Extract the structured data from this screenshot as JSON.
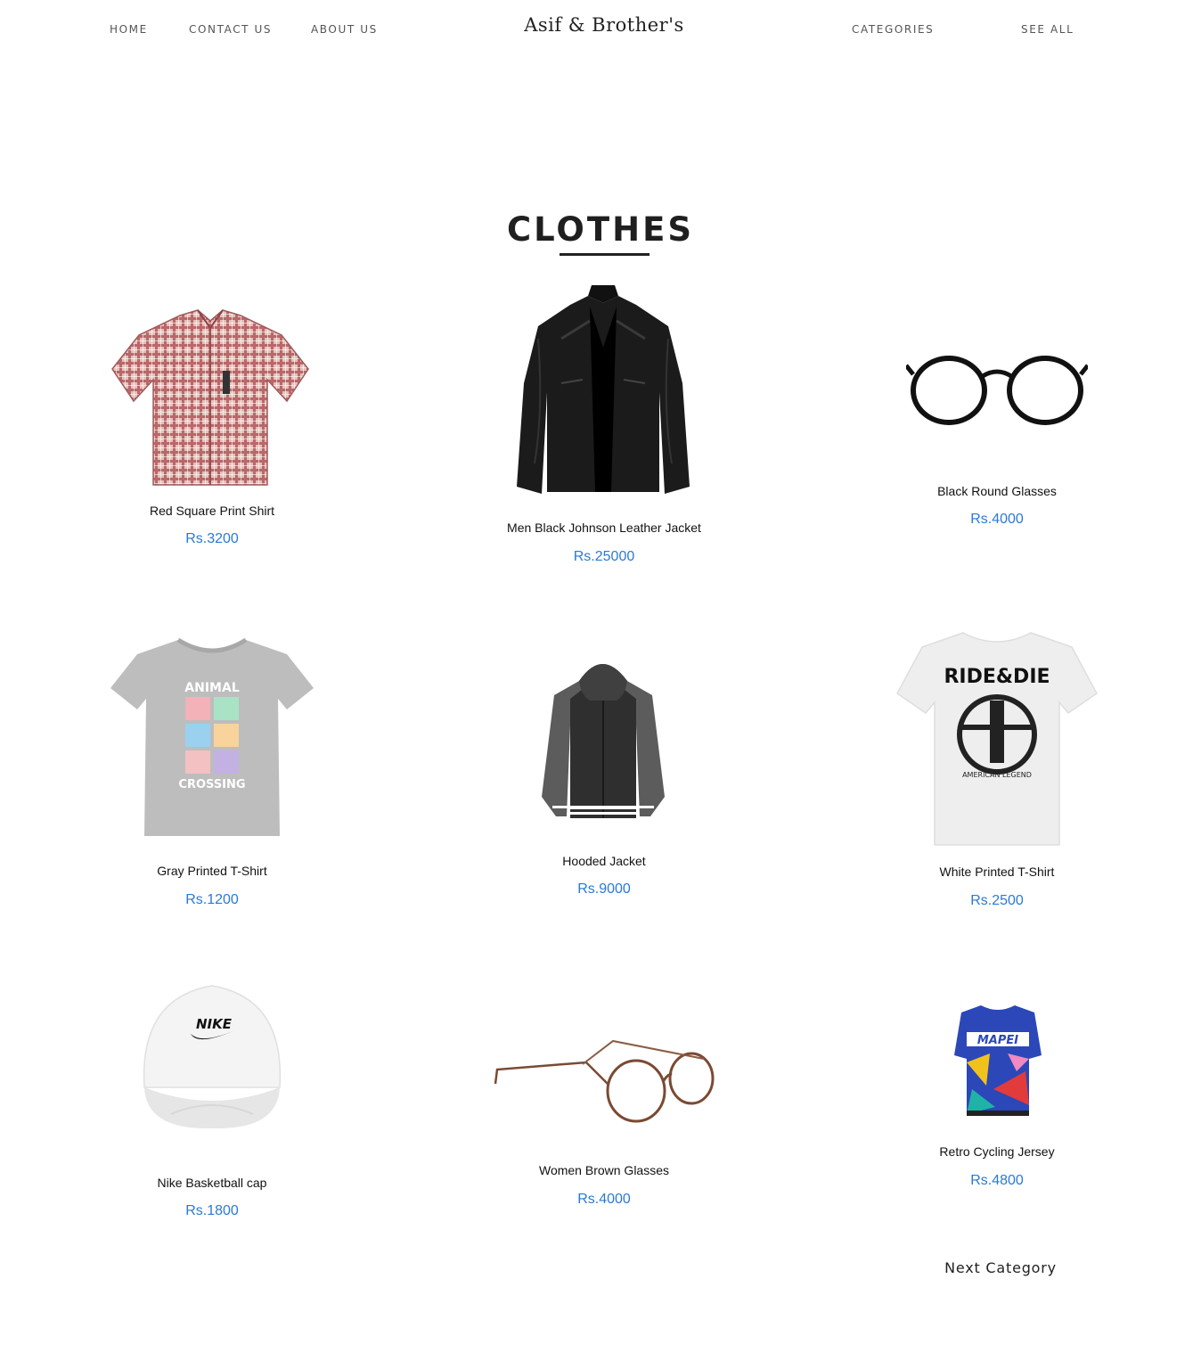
{
  "nav": {
    "home": "HOME",
    "contact": "CONTACT US",
    "about": "ABOUT US",
    "brand": "Asif & Brother's",
    "categories": "CATEGORIES",
    "see_all": "SEE ALL"
  },
  "section": {
    "title": "CLOTHES"
  },
  "products": [
    {
      "name": "Red Square Print Shirt",
      "price": "Rs.3200",
      "icon": "plaid-shirt"
    },
    {
      "name": "Men Black Johnson Leather Jacket",
      "price": "Rs.25000",
      "icon": "leather-jacket"
    },
    {
      "name": "Black Round Glasses",
      "price": "Rs.4000",
      "icon": "round-glasses"
    },
    {
      "name": "Gray Printed T-Shirt",
      "price": "Rs.1200",
      "icon": "gray-tshirt"
    },
    {
      "name": "Hooded Jacket",
      "price": "Rs.9000",
      "icon": "hooded-jacket"
    },
    {
      "name": "White Printed T-Shirt",
      "price": "Rs.2500",
      "icon": "white-tshirt"
    },
    {
      "name": "Nike Basketball cap",
      "price": "Rs.1800",
      "icon": "cap"
    },
    {
      "name": "Women Brown Glasses",
      "price": "Rs.4000",
      "icon": "brown-glasses"
    },
    {
      "name": "Retro Cycling Jersey",
      "price": "Rs.4800",
      "icon": "cycling-jersey"
    }
  ],
  "footer": {
    "next_category": "Next Category"
  }
}
